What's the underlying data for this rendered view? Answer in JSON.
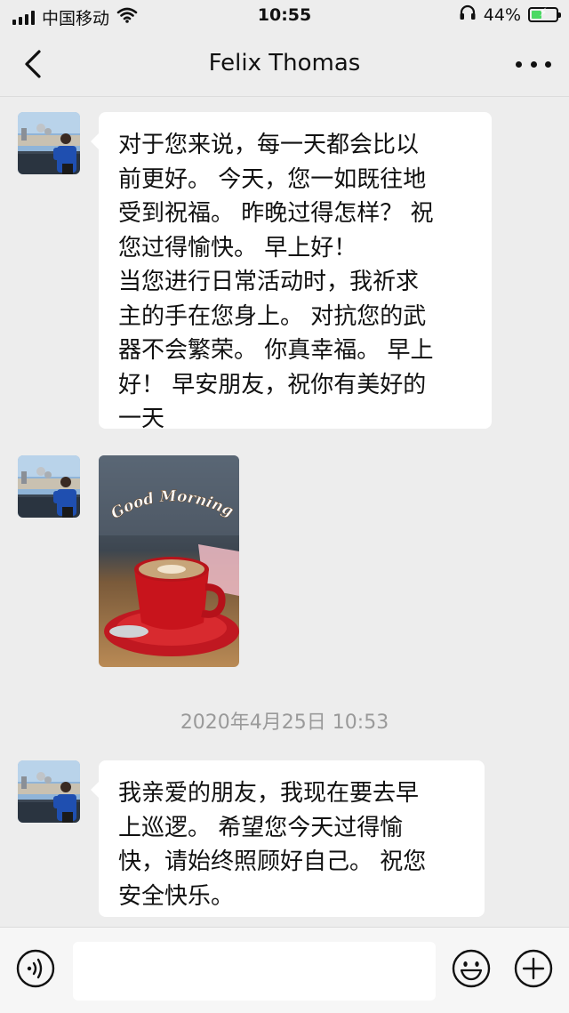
{
  "status_bar": {
    "carrier": "中国移动",
    "time": "10:55",
    "battery_percent": "44%",
    "battery_level": 0.44,
    "icons": [
      "signal-icon",
      "wifi-icon",
      "headphones-icon",
      "battery-charging-icon"
    ]
  },
  "nav": {
    "title": "Felix Thomas",
    "back_icon": "chevron-left-icon",
    "more_icon": "more-dots-icon"
  },
  "messages": [
    {
      "lines": [
        "对于您来说，每一天都会比以",
        "前更好。 今天，您一如既往地",
        "受到祝福。 昨晚过得怎样？ 祝",
        "您过得愉快。 早上好！",
        "当您进行日常活动时，我祈求",
        "主的手在您身上。 对抗您的武",
        "器不会繁荣。 你真幸福。 早上",
        "好！ 早安朋友，祝你有美好的",
        "一天"
      ]
    },
    {
      "image_caption": "Good Morning"
    },
    {
      "lines": [
        "我亲爱的朋友，我现在要去早",
        "上巡逻。 希望您今天过得愉",
        "快，请始终照顾好自己。 祝您",
        "安全快乐。"
      ]
    }
  ],
  "timestamp": "2020年4月25日 10:53",
  "input_bar": {
    "icons": [
      "voice-icon",
      "emoji-icon",
      "plus-icon"
    ],
    "value": ""
  },
  "colors": {
    "background": "#ededed",
    "bubble": "#ffffff",
    "battery_charge": "#4cd964",
    "timestamp": "#9a9a9a"
  }
}
